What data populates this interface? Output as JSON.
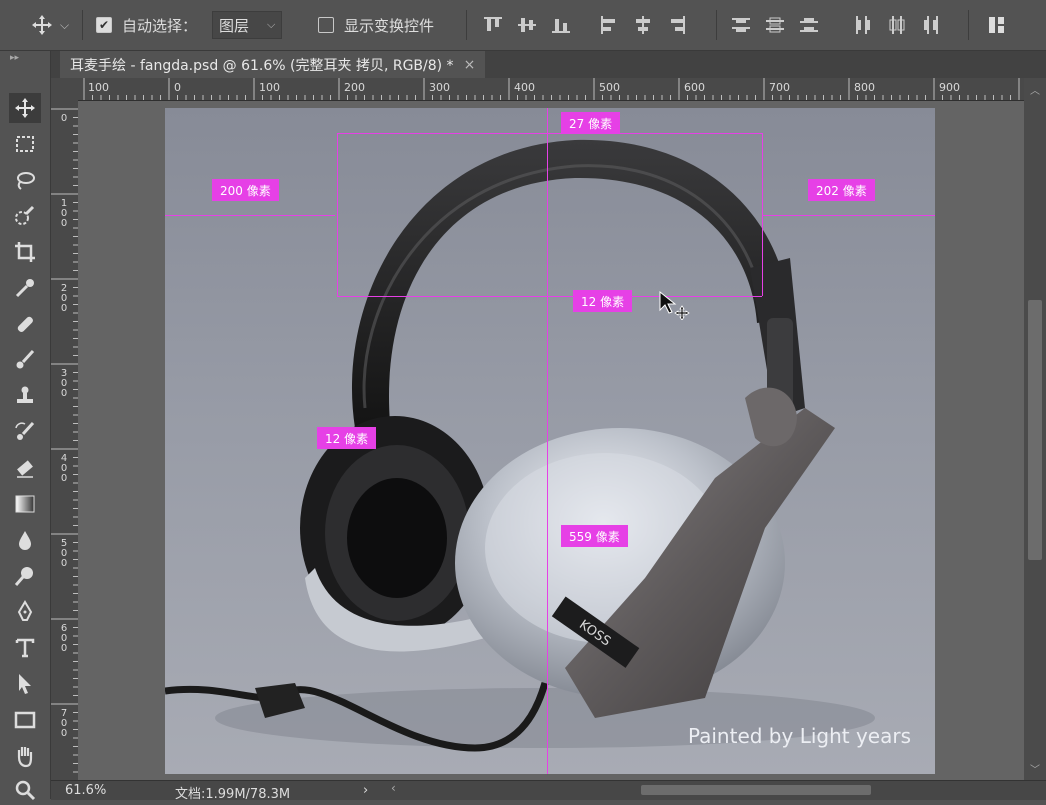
{
  "options_bar": {
    "move_tool": "move-tool-icon",
    "auto_select_checked": true,
    "auto_select_label": "自动选择：",
    "auto_select_target": "图层",
    "show_transform_checked": false,
    "show_transform_label": "显示变换控件"
  },
  "document_tab": {
    "title": "耳麦手绘 - fangda.psd @ 61.6% (完整耳夹 拷贝, RGB/8) *",
    "close": "×"
  },
  "ruler_top": [
    "100",
    "0",
    "100",
    "200",
    "300",
    "400",
    "500",
    "600",
    "700",
    "800",
    "900"
  ],
  "ruler_left": [
    "0",
    "100",
    "200",
    "300",
    "400",
    "500",
    "600",
    "700"
  ],
  "measurements": {
    "top": "27 像素",
    "left": "200 像素",
    "right": "202 像素",
    "inner": "12 像素",
    "earcup": "12 像素",
    "bottom": "559 像素"
  },
  "canvas": {
    "watermark": "Painted by Light years",
    "brand": "KOSS",
    "guide_color": "#e640e6"
  },
  "tools": [
    "move-tool-icon",
    "marquee-icon",
    "lasso-icon",
    "quick-select-icon",
    "crop-icon",
    "eyedropper-icon",
    "healing-brush-icon",
    "brush-icon",
    "stamp-icon",
    "history-brush-icon",
    "eraser-icon",
    "gradient-icon",
    "blur-icon",
    "dodge-icon",
    "pen-icon",
    "type-icon",
    "path-select-icon",
    "rectangle-icon",
    "hand-icon",
    "zoom-icon"
  ],
  "status_bar": {
    "zoom": "61.6%",
    "doc_info": "文档:1.99M/78.3M",
    "arrow": "›"
  }
}
